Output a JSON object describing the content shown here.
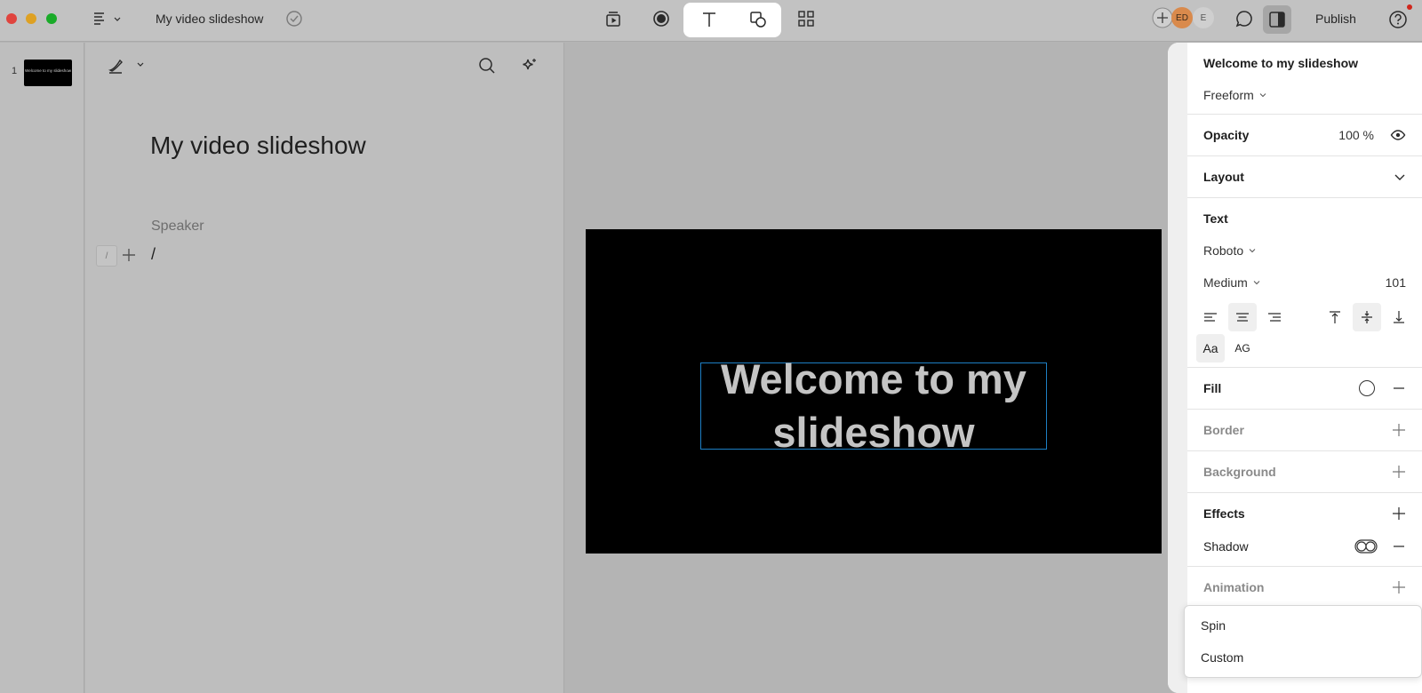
{
  "window": {
    "title": "My video slideshow"
  },
  "topbar": {
    "publish_label": "Publish",
    "avatars": [
      "ED",
      "E"
    ]
  },
  "slides": [
    {
      "number": "1",
      "thumb_text": "Welcome to my slideshow"
    }
  ],
  "editor": {
    "doc_title": "My video slideshow",
    "speaker_label": "Speaker",
    "slash_chip": "/",
    "current_text": "/"
  },
  "canvas": {
    "slide_text": "Welcome to my slideshow",
    "line1": "Welcome to my",
    "line2": "slideshow"
  },
  "panel": {
    "element_name": "Welcome to my slideshow",
    "mode": "Freeform",
    "opacity_label": "Opacity",
    "opacity_value": "100 %",
    "layout_label": "Layout",
    "text_label": "Text",
    "font_family": "Roboto",
    "font_weight": "Medium",
    "font_size": "101",
    "case_normal": "Aa",
    "case_upper": "AG",
    "fill_label": "Fill",
    "border_label": "Border",
    "background_label": "Background",
    "effects_label": "Effects",
    "shadow_label": "Shadow",
    "animation_label": "Animation"
  },
  "animation_menu": {
    "items": [
      "Spin",
      "Custom"
    ]
  },
  "colors": {
    "selection": "#1d7fc4",
    "notification_dot": "#d0261c",
    "close": "#e0443e",
    "minimize": "#dea123",
    "maximize": "#1aab29"
  }
}
